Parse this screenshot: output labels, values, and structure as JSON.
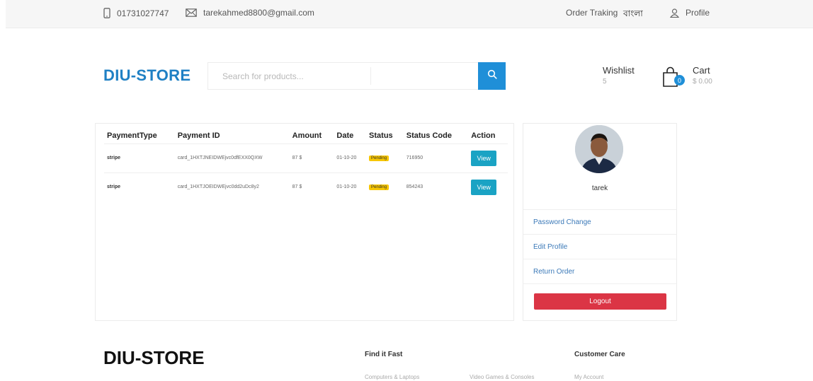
{
  "topbar": {
    "phone": "01731027747",
    "email": "tarekahmed8800@gmail.com",
    "order_tracking": "Order Traking",
    "language": "বাংলা",
    "profile": "Profile"
  },
  "header": {
    "logo": "DIU-STORE",
    "search_placeholder": "Search for products...",
    "wishlist_label": "Wishlist",
    "wishlist_count": "5",
    "cart_label": "Cart",
    "cart_amount": "$ 0.00",
    "cart_badge": "0"
  },
  "payments": {
    "headers": [
      "PaymentType",
      "Payment ID",
      "Amount",
      "Date",
      "Status",
      "Status Code",
      "Action"
    ],
    "rows": [
      {
        "type": "stripe",
        "payment_id": "card_1HXTJNEIDWEjvc0dfEXX0QXW",
        "amount": "87 $",
        "date": "01-10-20",
        "status": "Pending",
        "status_code": "716950",
        "action": "View"
      },
      {
        "type": "stripe",
        "payment_id": "card_1HXTJOEIDWEjvc0dd2uDc8y2",
        "amount": "87 $",
        "date": "01-10-20",
        "status": "Pending",
        "status_code": "854243",
        "action": "View"
      }
    ]
  },
  "profile": {
    "username": "tarek",
    "links": [
      "Password Change",
      "Edit Profile",
      "Return Order"
    ],
    "logout": "Logout"
  },
  "footer": {
    "logo": "DIU-STORE",
    "find_it_fast": "Find it Fast",
    "customer_care": "Customer Care",
    "links": [
      "Computers & Laptops",
      "Video Games & Consoles",
      "My Account"
    ]
  },
  "colors": {
    "brand": "#1f80c4",
    "search_button": "#1f8fd8",
    "view_button": "#1aa3c4",
    "pending_badge": "#f7c600",
    "logout": "#db3545"
  }
}
